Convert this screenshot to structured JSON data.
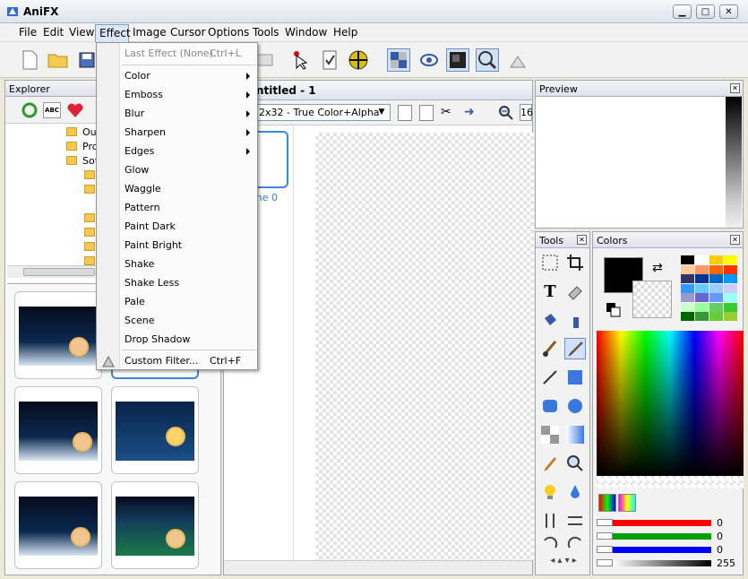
{
  "app": {
    "title": "AniFX"
  },
  "window_buttons": {
    "minimize": "▁",
    "maximize": "□",
    "close": "✕"
  },
  "menubar": {
    "items": [
      "File",
      "Edit",
      "View",
      "Effect",
      "Image",
      "Cursor",
      "Options",
      "Tools",
      "Window",
      "Help"
    ]
  },
  "effect_menu": {
    "last_effect": "Last Effect (None)",
    "last_effect_shortcut": "Ctrl+L",
    "submenus": [
      "Color",
      "Emboss",
      "Blur",
      "Sharpen",
      "Edges"
    ],
    "items": [
      "Glow",
      "Waggle",
      "Pattern",
      "Paint Dark",
      "Paint Bright",
      "Shake",
      "Shake Less",
      "Pale",
      "Scene",
      "Drop Shadow"
    ],
    "custom_filter": "Custom Filter...",
    "custom_filter_shortcut": "Ctrl+F"
  },
  "explorer": {
    "title": "Explorer",
    "tree": [
      "Ou",
      "Pro",
      "Sof"
    ],
    "abc_label": "ABC"
  },
  "document": {
    "title": "ntitled - 1",
    "format": "2x32 - True Color+Alpha",
    "frame_label": "me 0",
    "zoom": "16"
  },
  "preview": {
    "title": "Preview"
  },
  "tools": {
    "title": "Tools"
  },
  "colors": {
    "title": "Colors",
    "sliders": [
      {
        "name": "red",
        "value": "0",
        "color": "#ff0000"
      },
      {
        "name": "green",
        "value": "0",
        "color": "#00a000"
      },
      {
        "name": "blue",
        "value": "0",
        "color": "#0000ff"
      },
      {
        "name": "alpha",
        "value": "255",
        "color": "#404040"
      }
    ],
    "palette": [
      "#000000",
      "#ffffff",
      "#ffcc00",
      "#ffff00",
      "#ffcc99",
      "#ff9966",
      "#ff6600",
      "#ff3300",
      "#333366",
      "#003399",
      "#0066cc",
      "#0099ff",
      "#3399ff",
      "#66ccff",
      "#99ccff",
      "#ccccff",
      "#9999cc",
      "#6666cc",
      "#6699ff",
      "#99ffff",
      "#ccffcc",
      "#99ff99",
      "#66cc66",
      "#33cc33",
      "#006600",
      "#339933",
      "#66cc33",
      "#99cc33"
    ]
  },
  "close_glyph": "✕"
}
